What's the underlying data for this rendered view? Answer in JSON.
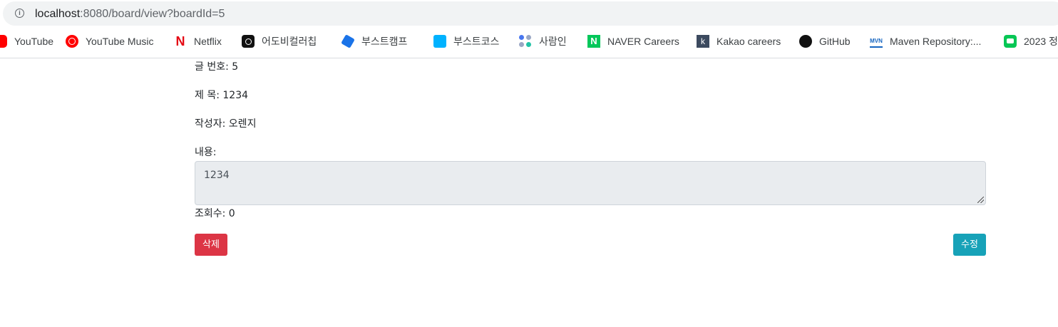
{
  "browser": {
    "url_host": "localhost",
    "url_path": ":8080/board/view?boardId=5"
  },
  "bookmarks": [
    {
      "label": "YouTube",
      "icon": "youtube-icon"
    },
    {
      "label": "YouTube Music",
      "icon": "youtube-music-icon"
    },
    {
      "label": "Netflix",
      "icon": "netflix-icon"
    },
    {
      "label": "어도비컬러칩",
      "icon": "adobe-color-icon"
    },
    {
      "label": "부스트캠프",
      "icon": "boostcamp-icon"
    },
    {
      "label": "부스트코스",
      "icon": "boostcourse-icon"
    },
    {
      "label": "사람인",
      "icon": "saramin-icon"
    },
    {
      "label": "NAVER Careers",
      "icon": "naver-icon"
    },
    {
      "label": "Kakao careers",
      "icon": "kakao-icon"
    },
    {
      "label": "GitHub",
      "icon": "github-icon"
    },
    {
      "label": "Maven Repository:...",
      "icon": "maven-icon"
    },
    {
      "label": "2023 정",
      "icon": "line-icon"
    }
  ],
  "post": {
    "number_label": "글 번호: 5",
    "title_label": "제 목: 1234",
    "author_label": "작성자: 오렌지",
    "content_label": "내용:",
    "content_value": "1234",
    "views_label": "조회수: 0"
  },
  "actions": {
    "delete_label": "삭제",
    "edit_label": "수정",
    "delete_color": "#dc3545",
    "edit_color": "#17a2b8"
  }
}
